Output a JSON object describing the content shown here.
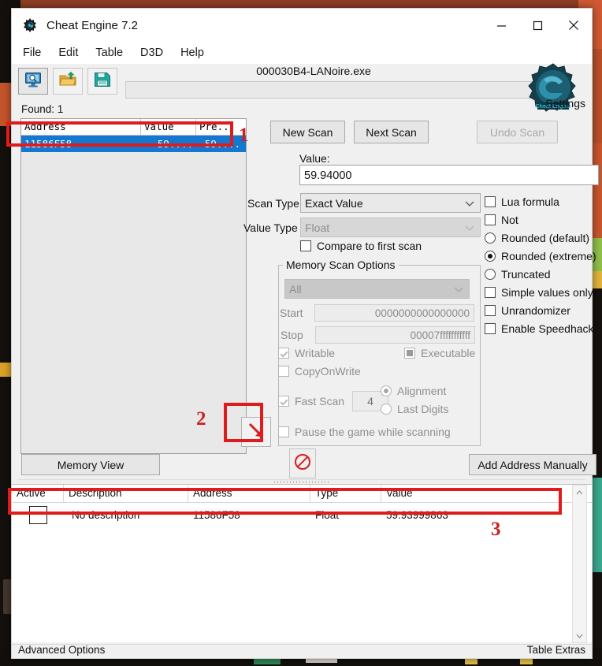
{
  "window": {
    "title": "Cheat Engine 7.2",
    "app_icon": "cheat-engine-icon",
    "controls": {
      "minimize": "—",
      "maximize": "☐",
      "close": "✕"
    }
  },
  "menu": {
    "items": [
      "File",
      "Edit",
      "Table",
      "D3D",
      "Help"
    ]
  },
  "toolbar": {
    "buttons": [
      {
        "name": "open-process-button",
        "icon": "monitor-magnifier-icon"
      },
      {
        "name": "open-table-button",
        "icon": "open-folder-icon"
      },
      {
        "name": "save-table-button",
        "icon": "floppy-save-icon"
      }
    ],
    "process_name": "000030B4-LANoire.exe",
    "settings_label": "Settings",
    "logo_icon": "cheat-engine-logo"
  },
  "results": {
    "found_label": "Found: 1",
    "columns": [
      "Address",
      "Value",
      "Pre..."
    ],
    "rows": [
      {
        "address": "11586F58",
        "value": "59....",
        "previous": "59...."
      }
    ]
  },
  "scan": {
    "new_scan": "New Scan",
    "next_scan": "Next Scan",
    "undo_scan": "Undo Scan",
    "value_label": "Value:",
    "value_input": "59.94000",
    "scan_type_label": "Scan Type",
    "scan_type_value": "Exact Value",
    "value_type_label": "Value Type",
    "value_type_value": "Float",
    "compare_first_label": "Compare to first scan",
    "options": [
      {
        "label": "Lua formula",
        "type": "checkbox",
        "checked": false
      },
      {
        "label": "Not",
        "type": "checkbox",
        "checked": false
      },
      {
        "label": "Rounded (default)",
        "type": "radio",
        "checked": false
      },
      {
        "label": "Rounded (extreme)",
        "type": "radio",
        "checked": true
      },
      {
        "label": "Truncated",
        "type": "radio",
        "checked": false
      },
      {
        "label": "Simple values only",
        "type": "checkbox",
        "checked": false
      },
      {
        "label": "Unrandomizer",
        "type": "checkbox",
        "checked": false
      },
      {
        "label": "Enable Speedhack",
        "type": "checkbox",
        "checked": false
      }
    ]
  },
  "memory_options": {
    "legend": "Memory Scan Options",
    "region": "All",
    "start_label": "Start",
    "start_value": "0000000000000000",
    "stop_label": "Stop",
    "stop_value": "00007fffffffffff",
    "writable_label": "Writable",
    "executable_label": "Executable",
    "copyonwrite_label": "CopyOnWrite",
    "fast_scan_label": "Fast Scan",
    "fast_scan_value": "4",
    "alignment_label": "Alignment",
    "last_digits_label": "Last Digits",
    "pause_label": "Pause the game while scanning"
  },
  "lower_toolbar": {
    "memory_view": "Memory View",
    "add_address": "Add Address Manually",
    "cancel_icon": "no-entry-icon",
    "arrow_icon": "red-arrow-down-right-icon"
  },
  "cheat_table": {
    "columns": [
      "Active",
      "Description",
      "Address",
      "Type",
      "Value"
    ],
    "rows": [
      {
        "active": false,
        "description": "No description",
        "address": "11586F58",
        "type": "Float",
        "value": "59.93999863"
      }
    ]
  },
  "status_bar": {
    "left": "Advanced Options",
    "right": "Table Extras"
  },
  "annotations": [
    {
      "number": "1"
    },
    {
      "number": "2"
    },
    {
      "number": "3"
    }
  ],
  "colors": {
    "annotation_red": "#e01b1b",
    "selection_blue": "#1478d0",
    "window_bg": "#f0f0f0"
  }
}
